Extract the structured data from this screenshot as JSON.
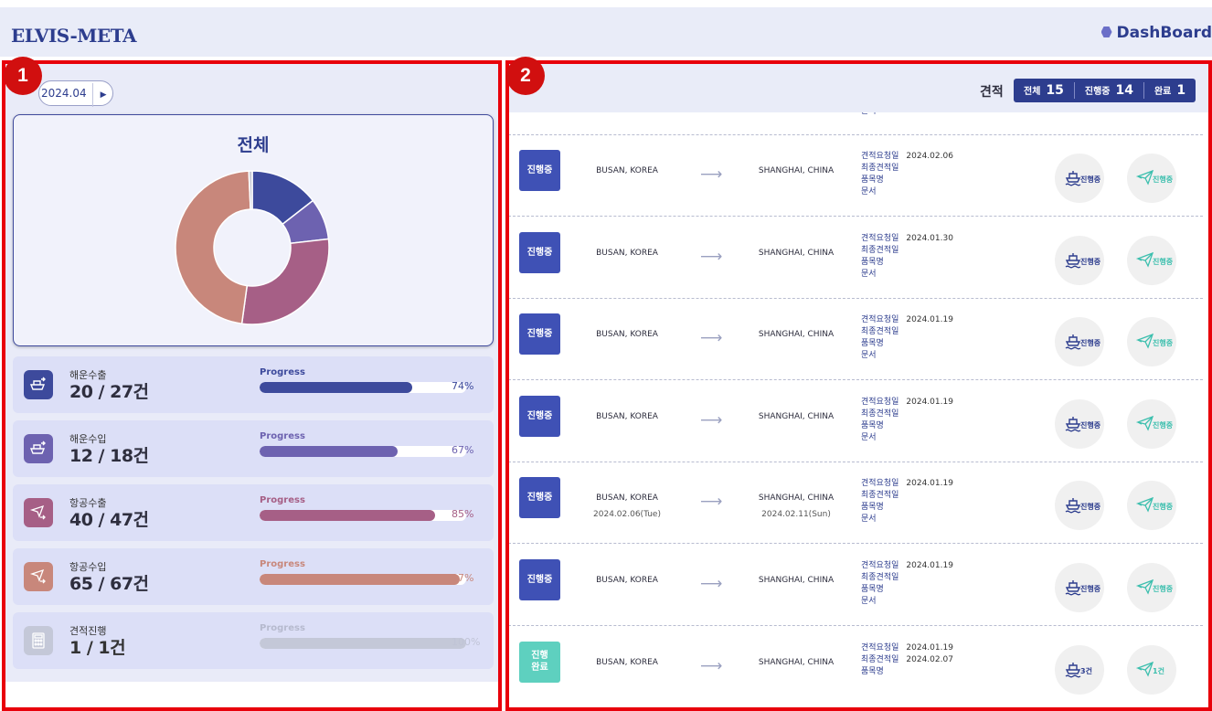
{
  "header": {
    "logo": "ELVIS-META",
    "dashboard": "DashBoard"
  },
  "annotations": [
    "1",
    "2"
  ],
  "left": {
    "month": "2024.04",
    "chart_title": "전체",
    "chart_data": {
      "type": "pie",
      "categories": [
        "해운수출",
        "해운수입",
        "항공수출",
        "항공수입",
        "견적진행"
      ],
      "values": [
        20,
        12,
        40,
        65,
        1
      ],
      "colors": [
        "#3d4a9c",
        "#6d62b0",
        "#a65f86",
        "#c8877b",
        "#c9cbd6"
      ]
    },
    "stats": [
      {
        "label": "해운수출",
        "count": "20 / 27건",
        "progress_label": "Progress",
        "progress": 0.74,
        "pct": "74%",
        "color": "#3d4a9c",
        "icon": "ship-export-icon"
      },
      {
        "label": "해운수입",
        "count": "12 / 18건",
        "progress_label": "Progress",
        "progress": 0.67,
        "pct": "67%",
        "color": "#6d62b0",
        "icon": "ship-import-icon"
      },
      {
        "label": "항공수출",
        "count": "40 / 47건",
        "progress_label": "Progress",
        "progress": 0.85,
        "pct": "85%",
        "color": "#a65f86",
        "icon": "plane-export-icon"
      },
      {
        "label": "항공수입",
        "count": "65 / 67건",
        "progress_label": "Progress",
        "progress": 0.97,
        "pct": "97%",
        "color": "#c8877b",
        "icon": "plane-import-icon"
      },
      {
        "label": "견적진행",
        "count": "1 / 1건",
        "progress_label": "Progress",
        "progress": 1.0,
        "pct": "100%",
        "color": "#c4c8d8",
        "icon": "calculator-icon"
      }
    ]
  },
  "right": {
    "quote_label": "견적",
    "tabs": [
      {
        "label": "전체",
        "count": "15"
      },
      {
        "label": "진행중",
        "count": "14"
      },
      {
        "label": "완료",
        "count": "1"
      }
    ],
    "partial_row_text": "문서",
    "rows": [
      {
        "status": "진행중",
        "done": false,
        "from": "BUSAN, KOREA",
        "to": "SHANGHAI, CHINA",
        "from_date": "",
        "to_date": "",
        "req_label": "견적요청일",
        "req_date": "2024.02.06",
        "final_label": "최종견적일",
        "final_date": "",
        "item_label": "품목명",
        "doc_label": "문서",
        "ship_badge": "진행중",
        "air_badge": "진행중"
      },
      {
        "status": "진행중",
        "done": false,
        "from": "BUSAN, KOREA",
        "to": "SHANGHAI, CHINA",
        "from_date": "",
        "to_date": "",
        "req_label": "견적요청일",
        "req_date": "2024.01.30",
        "final_label": "최종견적일",
        "final_date": "",
        "item_label": "품목명",
        "doc_label": "문서",
        "ship_badge": "진행중",
        "air_badge": "진행중"
      },
      {
        "status": "진행중",
        "done": false,
        "from": "BUSAN, KOREA",
        "to": "SHANGHAI, CHINA",
        "from_date": "",
        "to_date": "",
        "req_label": "견적요청일",
        "req_date": "2024.01.19",
        "final_label": "최종견적일",
        "final_date": "",
        "item_label": "품목명",
        "doc_label": "문서",
        "ship_badge": "진행중",
        "air_badge": "진행중"
      },
      {
        "status": "진행중",
        "done": false,
        "from": "BUSAN, KOREA",
        "to": "SHANGHAI, CHINA",
        "from_date": "",
        "to_date": "",
        "req_label": "견적요청일",
        "req_date": "2024.01.19",
        "final_label": "최종견적일",
        "final_date": "",
        "item_label": "품목명",
        "doc_label": "문서",
        "ship_badge": "진행중",
        "air_badge": "진행중"
      },
      {
        "status": "진행중",
        "done": false,
        "from": "BUSAN, KOREA",
        "to": "SHANGHAI, CHINA",
        "from_date": "2024.02.06(Tue)",
        "to_date": "2024.02.11(Sun)",
        "req_label": "견적요청일",
        "req_date": "2024.01.19",
        "final_label": "최종견적일",
        "final_date": "",
        "item_label": "품목명",
        "doc_label": "문서",
        "ship_badge": "진행중",
        "air_badge": "진행중"
      },
      {
        "status": "진행중",
        "done": false,
        "from": "BUSAN, KOREA",
        "to": "SHANGHAI, CHINA",
        "from_date": "",
        "to_date": "",
        "req_label": "견적요청일",
        "req_date": "2024.01.19",
        "final_label": "최종견적일",
        "final_date": "",
        "item_label": "품목명",
        "doc_label": "문서",
        "ship_badge": "진행중",
        "air_badge": "진행중"
      },
      {
        "status": "진행\n완료",
        "done": true,
        "from": "BUSAN, KOREA",
        "to": "SHANGHAI, CHINA",
        "from_date": "",
        "to_date": "",
        "req_label": "견적요청일",
        "req_date": "2024.01.19",
        "final_label": "최종견적일",
        "final_date": "2024.02.07",
        "item_label": "품목명",
        "doc_label": "",
        "ship_badge": "3건",
        "air_badge": "1건"
      }
    ]
  }
}
